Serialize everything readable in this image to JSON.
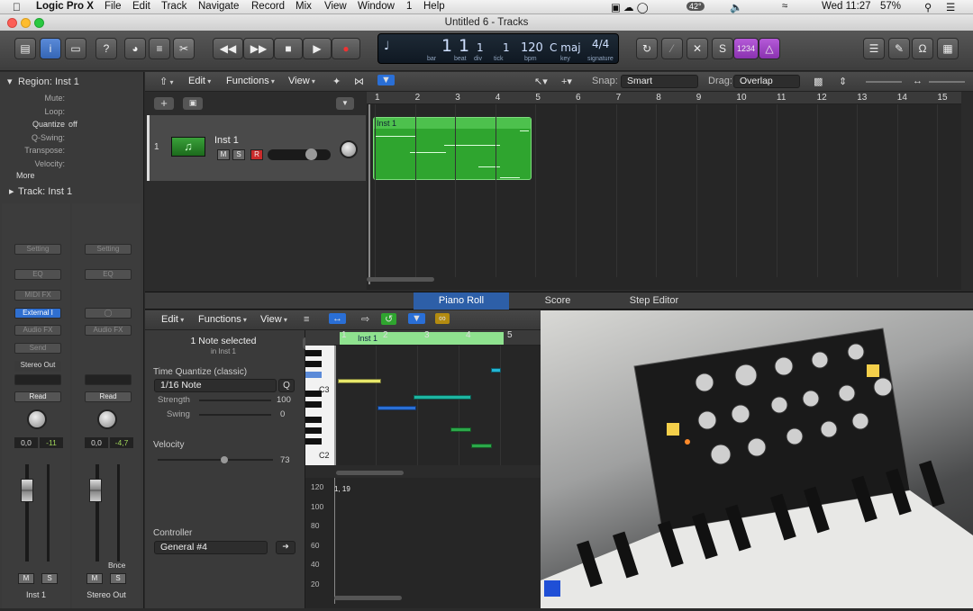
{
  "menubar": {
    "app": "Logic Pro X",
    "items": [
      "File",
      "Edit",
      "Track",
      "Navigate",
      "Record",
      "Mix",
      "View",
      "Window",
      "1",
      "Help"
    ],
    "temp": "42°",
    "day_time": "Wed 11:27",
    "battery": "57%"
  },
  "window": {
    "title": "Untitled 6 - Tracks"
  },
  "lcd": {
    "bar": "1",
    "beat": "1",
    "div": "1",
    "tick": "1",
    "bpm": "120",
    "key": "C maj",
    "signature": "4/4",
    "bar_lbl": "bar",
    "beat_lbl": "beat",
    "div_lbl": "div",
    "tick_lbl": "tick",
    "bpm_lbl": "bpm",
    "key_lbl": "key",
    "sig_lbl": "signature"
  },
  "toolbar": {
    "cycle_counter": "1234"
  },
  "inspector": {
    "region_header": "Region: Inst 1",
    "mute": "Mute:",
    "loop": "Loop:",
    "quantize": "Quantize",
    "quantize_val": "off",
    "qswing": "Q-Swing:",
    "transpose": "Transpose:",
    "velocity": "Velocity:",
    "more": "More",
    "track_header": "Track: Inst 1",
    "strip1": {
      "setting": "Setting",
      "eq": "EQ",
      "midifx": "MIDI FX",
      "input": "External I",
      "audiofx": "Audio FX",
      "send": "Send",
      "output": "Stereo Out",
      "auto": "Read",
      "pan": "0,0",
      "level": "-11",
      "name": "Inst 1",
      "m": "M",
      "s": "S"
    },
    "strip2": {
      "setting": "Setting",
      "eq": "EQ",
      "audiofx": "Audio FX",
      "auto": "Read",
      "pan": "0,0",
      "level": "-4,7",
      "bounce": "Bnce",
      "name": "Stereo Out",
      "m": "M",
      "s": "S"
    }
  },
  "tracks": {
    "menus": [
      "Edit",
      "Functions",
      "View"
    ],
    "snap_lbl": "Snap:",
    "snap": "Smart",
    "drag_lbl": "Drag:",
    "drag": "Overlap",
    "ruler": [
      "1",
      "2",
      "3",
      "4",
      "5",
      "6",
      "7",
      "8",
      "9",
      "10",
      "11",
      "12",
      "13",
      "14",
      "15"
    ],
    "track": {
      "num": "1",
      "name": "Inst 1",
      "m": "M",
      "s": "S",
      "r": "R"
    },
    "region": "Inst 1"
  },
  "editor": {
    "tabs": [
      "Piano Roll",
      "Score",
      "Step Editor"
    ],
    "menus": [
      "Edit",
      "Functions",
      "View"
    ],
    "selected": "1 Note selected",
    "selected_sub": "in Inst 1",
    "tq_lbl": "Time Quantize (classic)",
    "tq_val": "1/16 Note",
    "q": "Q",
    "strength_lbl": "Strength",
    "strength": "100",
    "swing_lbl": "Swing",
    "swing": "0",
    "velocity_lbl": "Velocity",
    "velocity": "73",
    "controller_lbl": "Controller",
    "controller": "General #4",
    "ruler": [
      "1",
      "2",
      "3",
      "4",
      "5"
    ],
    "region": "Inst 1",
    "c3": "C3",
    "c2": "C2",
    "vel_axis": [
      "120",
      "100",
      "80",
      "60",
      "40",
      "20"
    ],
    "vel_marker": "1, 19"
  },
  "colors": {
    "region_green": "#2fa52f",
    "accent_blue": "#2a6fd6",
    "record_red": "#c92b2b"
  }
}
